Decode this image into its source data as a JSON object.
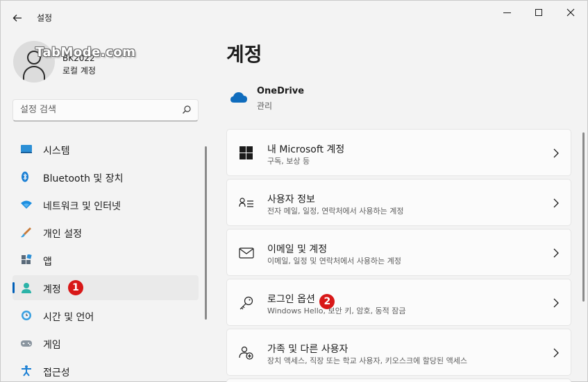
{
  "window": {
    "title": "설정",
    "controls": {
      "minimize": "minimize",
      "maximize": "maximize",
      "close": "close"
    }
  },
  "profile": {
    "watermark": "TabMode.com",
    "name": "BK2022",
    "type": "로컬 계정"
  },
  "search": {
    "placeholder": "설정 검색"
  },
  "nav": {
    "items": [
      {
        "label": "시스템",
        "icon": "system-icon"
      },
      {
        "label": "Bluetooth 및 장치",
        "icon": "bluetooth-icon"
      },
      {
        "label": "네트워크 및 인터넷",
        "icon": "network-icon"
      },
      {
        "label": "개인 설정",
        "icon": "brush-icon"
      },
      {
        "label": "앱",
        "icon": "apps-icon"
      },
      {
        "label": "계정",
        "icon": "account-icon",
        "selected": true
      },
      {
        "label": "시간 및 언어",
        "icon": "time-language-icon"
      },
      {
        "label": "게임",
        "icon": "gaming-icon"
      },
      {
        "label": "접근성",
        "icon": "accessibility-icon"
      }
    ],
    "badge": "1"
  },
  "main": {
    "title": "계정",
    "onedrive": {
      "name": "OneDrive",
      "sub": "관리"
    },
    "cards": [
      {
        "title": "내 Microsoft 계정",
        "sub": "구독, 보상 등",
        "icon": "windows-logo-icon"
      },
      {
        "title": "사용자 정보",
        "sub": "전자 메일, 일정, 연락처에서 사용하는 계정",
        "icon": "user-info-icon"
      },
      {
        "title": "이메일 및 계정",
        "sub": "이메일, 일정 및 연락처에서 사용하는 계정",
        "icon": "mail-icon"
      },
      {
        "title": "로그인 옵션",
        "sub": "Windows Hello, 보안 키, 암호, 동적 잠금",
        "icon": "key-icon"
      },
      {
        "title": "가족 및 다른 사용자",
        "sub": "장치 액세스, 직장 또는 학교 사용자, 키오스크에 할당된 액세스",
        "icon": "family-icon"
      }
    ],
    "badge": "2"
  },
  "colors": {
    "accent": "#005fb8",
    "badge": "#d81818",
    "onedrive": "#0f6cbd"
  }
}
